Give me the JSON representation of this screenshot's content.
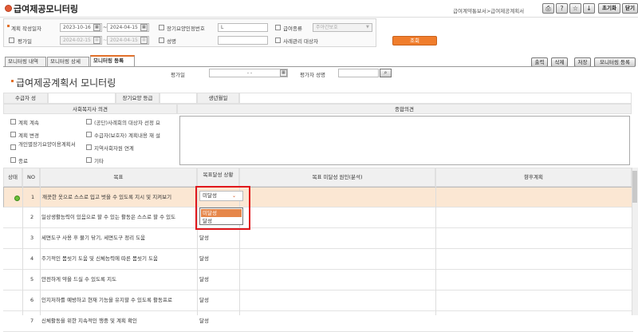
{
  "window": {
    "title": "급여제공모니터링",
    "breadcrumb": "급여계약통보서>급여제공계획서",
    "buttons": {
      "reset": "초기화",
      "close": "닫기"
    },
    "icons": [
      "print-icon",
      "help-icon",
      "favorite-icon",
      "download-icon"
    ]
  },
  "filters": {
    "contract_date_label": "계획 작성일자",
    "contract_start": "2023-10-16",
    "contract_end": "2024-04-15",
    "ltc_no_label": "장기요양인정번호",
    "ltc_no_value": "L",
    "benefit_type_label": "급여종류",
    "benefit_type_value": "주야간보호",
    "eval_date_label": "평가일",
    "eval_start": "2024-02-15",
    "eval_end": "2024-04-15",
    "name_label": "성명",
    "name_value": "",
    "case_mgmt_label": "사례관리 대상자",
    "search_button": "조회"
  },
  "tabs": [
    {
      "label": "모니터링 내역",
      "active": false
    },
    {
      "label": "모니터링 상세",
      "active": false
    },
    {
      "label": "모니터링 등록",
      "active": true
    }
  ],
  "actions": {
    "print": "출력",
    "delete": "삭제",
    "save": "저장",
    "register": "모니터링 등록"
  },
  "plan": {
    "title": "급여제공계획서 모니터링",
    "eval_date_label": "평가일",
    "eval_date_value": "- -",
    "evaluator_label": "평가자 성명",
    "evaluator_value": ""
  },
  "recipient": {
    "name_label": "수급자 성",
    "grade_label": "장기요양 등급",
    "birth_label": "생년월일"
  },
  "social_worker": {
    "section_label": "사회복지사 의견",
    "overall_label": "종합의견",
    "options": [
      "계획 계속",
      "(공단)사례회의 대상자 선정 요",
      "계획 변경",
      "수급자(보호자) 계획내용 재 설",
      "개인별장기요양이용계획서",
      "지역사회자원 연계",
      "종료",
      "기타"
    ]
  },
  "goal_table": {
    "headers": [
      "상태",
      "NO",
      "목표",
      "목표달성 상황",
      "목표 미달성 원인(분석)",
      "향후계획"
    ],
    "rows": [
      {
        "no": "1",
        "goal": "깨끗한 옷으로 스스로 입고 벗을 수 있도록 지시 및 지켜보기",
        "status": "미달성"
      },
      {
        "no": "2",
        "goal": "일상생활능력이 있음으로 할 수 있는 활동은 스스로 할 수 있도",
        "status": ""
      },
      {
        "no": "3",
        "goal": "세면도구 사용 후 물기 닦기, 세면도구 정리 도움",
        "status": "달성"
      },
      {
        "no": "4",
        "goal": "주기적인 몸씻기 도움 및 신체능력에 따른 몸씻기 도움",
        "status": "달성"
      },
      {
        "no": "5",
        "goal": "안전하게 약을 드실 수 있도록 지도",
        "status": "달성"
      },
      {
        "no": "6",
        "goal": "인지저하를 예방하고 현재 기능을 유지할 수 있도록 활동프로",
        "status": "달성"
      },
      {
        "no": "7",
        "goal": "신체활동을 위한 지속적인 행중 및 계획 확인",
        "status": "달성"
      }
    ],
    "dropdown_options": [
      "미달성",
      "달성"
    ]
  }
}
